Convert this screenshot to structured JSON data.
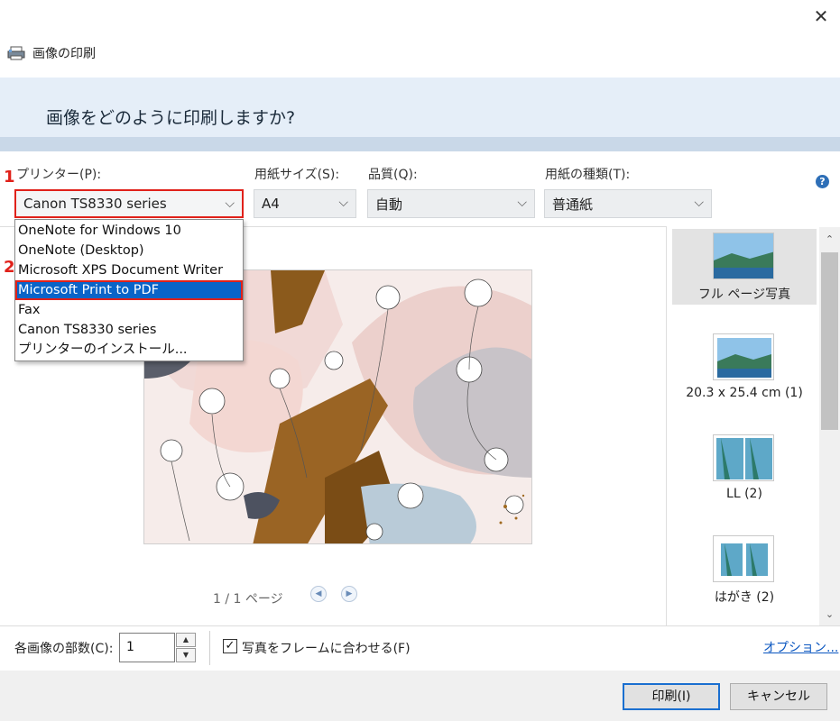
{
  "window": {
    "close_glyph": "✕",
    "title": "画像の印刷",
    "app_icon": "printer-icon"
  },
  "header": {
    "question": "画像をどのように印刷しますか?"
  },
  "annotations": {
    "step1": "1",
    "step2": "2",
    "accent_color": "#e0211a"
  },
  "settings": {
    "printer_label": "プリンター(P):",
    "printer_value": "Canon TS8330 series",
    "paper_size_label": "用紙サイズ(S):",
    "paper_size_value": "A4",
    "quality_label": "品質(Q):",
    "quality_value": "自動",
    "paper_type_label": "用紙の種類(T):",
    "paper_type_value": "普通紙",
    "help_glyph": "?"
  },
  "printer_dropdown": {
    "items": [
      "OneNote for Windows 10",
      "OneNote (Desktop)",
      "Microsoft XPS Document Writer",
      "Microsoft Print to PDF",
      "Fax",
      "Canon TS8330 series",
      "プリンターのインストール..."
    ],
    "selected_index": 3,
    "highlight_color": "#0a64c8"
  },
  "preview": {
    "page_info": "1 / 1 ページ"
  },
  "layouts": [
    {
      "label": "フル ページ写真",
      "selected": true
    },
    {
      "label": "20.3 x 25.4 cm (1)",
      "selected": false
    },
    {
      "label": "LL (2)",
      "selected": false
    },
    {
      "label": "はがき (2)",
      "selected": false
    }
  ],
  "bottom": {
    "copies_label": "各画像の部数(C):",
    "copies_value": "1",
    "fit_label": "写真をフレームに合わせる(F)",
    "fit_checked": true,
    "options_link": "オプション..."
  },
  "buttons": {
    "print": "印刷(I)",
    "cancel": "キャンセル"
  }
}
